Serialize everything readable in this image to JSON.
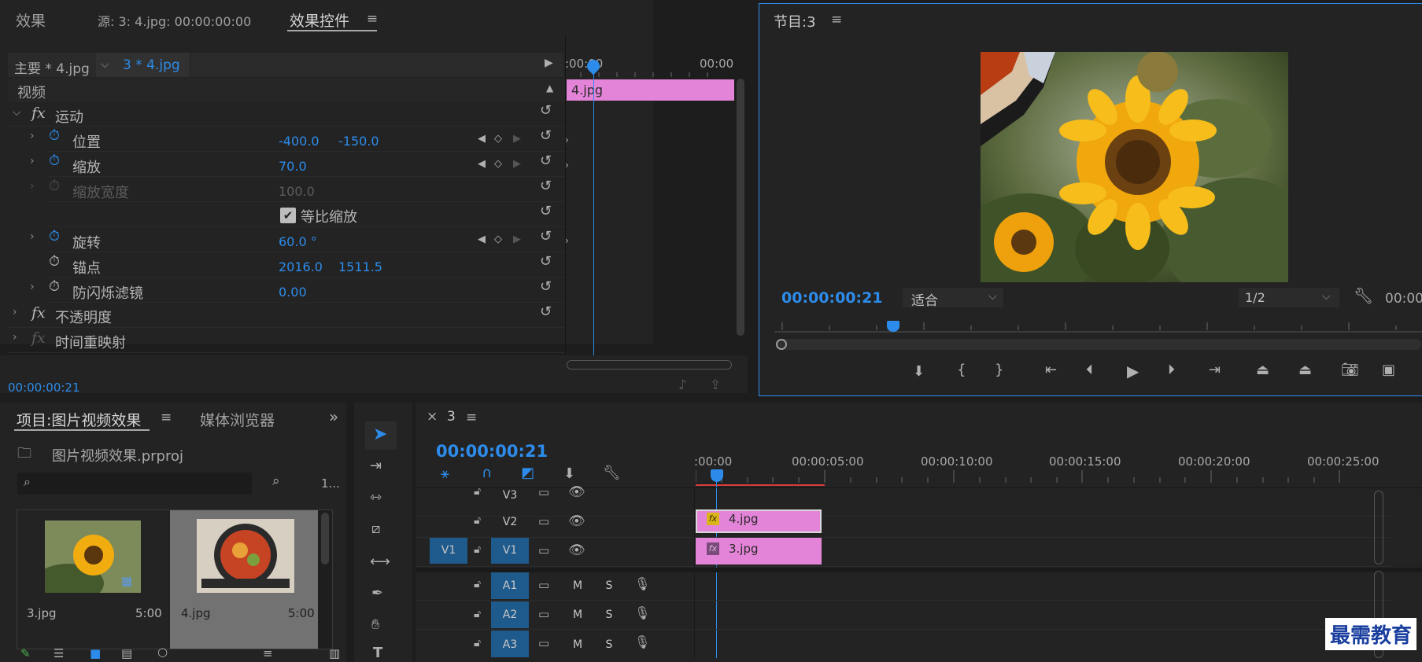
{
  "effect_controls_panel": {
    "tabs": {
      "effects": "效果",
      "source": "源: 3: 4.jpg: 00:00:00:00",
      "effect_controls": "效果控件"
    },
    "menu_icon": "hamburger-icon",
    "master_clip": "主要 * 4.jpg",
    "sequence_clip": "3 * 4.jpg",
    "ruler_start": ":00:00",
    "ruler_end": "00:00",
    "clip_bar_label": "4.jpg",
    "section_video": "视频",
    "fx_label": "fx",
    "motion": "运动",
    "properties": [
      {
        "name": "位置",
        "v1": "-400.0",
        "v2": "-150.0"
      },
      {
        "name": "缩放",
        "v1": "70.0"
      },
      {
        "name": "缩放宽度",
        "v1": "100.0"
      },
      {
        "name": "等比缩放"
      },
      {
        "name": "旋转",
        "v1": "60.0 °"
      },
      {
        "name": "锚点",
        "v1": "2016.0",
        "v2": "1511.5"
      },
      {
        "name": "防闪烁滤镜",
        "v1": "0.00"
      }
    ],
    "opacity": "不透明度",
    "time_remap": "时间重映射",
    "timecode": "00:00:00:21"
  },
  "program_monitor": {
    "title": "节目:3",
    "timecode": "00:00:00:21",
    "fit_label": "适合",
    "resolution": "1/2",
    "end_timecode": "00:00"
  },
  "project_panel": {
    "tab_project": "项目:图片视频效果",
    "tab_media": "媒体浏览器",
    "project_file": "图片视频效果.prproj",
    "search_placeholder": "",
    "count": "1...",
    "items": [
      {
        "name": "3.jpg",
        "duration": "5:00"
      },
      {
        "name": "4.jpg",
        "duration": "5:00"
      }
    ]
  },
  "timeline_panel": {
    "close": "×",
    "sequence_name": "3",
    "timecode": "00:00:00:21",
    "ruler": [
      ":00:00",
      "00:00:05:00",
      "00:00:10:00",
      "00:00:15:00",
      "00:00:20:00",
      "00:00:25:00"
    ],
    "tracks": {
      "v3": "V3",
      "v2": "V2",
      "v1_src": "V1",
      "v1": "V1",
      "a1": "A1",
      "a2": "A2",
      "a3": "A3",
      "m": "M",
      "s": "S"
    },
    "clips": {
      "v2": "4.jpg",
      "v1": "3.jpg",
      "fx": "fx"
    }
  },
  "watermark": "最需教育",
  "colors": {
    "accent": "#2d8ceb",
    "clip_pink": "#e07fd8",
    "panel": "#232323",
    "bg": "#1d1d1d"
  }
}
